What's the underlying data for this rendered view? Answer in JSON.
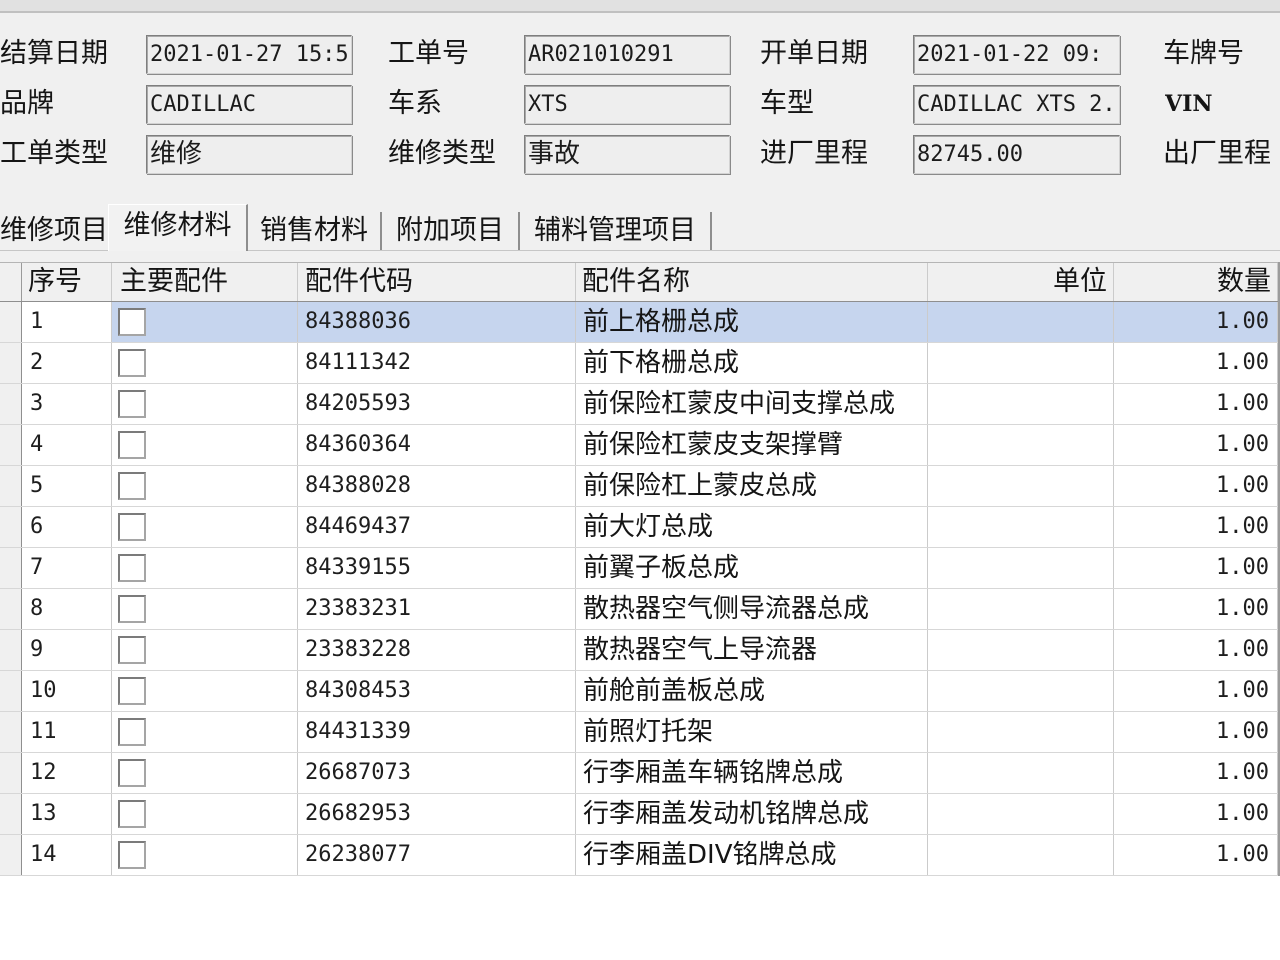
{
  "theme": {
    "selection": "#c6d5ee"
  },
  "form": {
    "settle_date": {
      "label": "结算日期",
      "value": "2021-01-27 15:5"
    },
    "work_order_no": {
      "label": "工单号",
      "value": "AR021010291"
    },
    "open_date": {
      "label": "开单日期",
      "value": "2021-01-22 09:"
    },
    "plate_no": {
      "label": "车牌号"
    },
    "brand": {
      "label": "品牌",
      "value": "CADILLAC"
    },
    "series": {
      "label": "车系",
      "value": "XTS"
    },
    "model": {
      "label": "车型",
      "value": "CADILLAC XTS 2."
    },
    "vin": {
      "label": "VIN"
    },
    "order_type": {
      "label": "工单类型",
      "value": "维修"
    },
    "repair_type": {
      "label": "维修类型",
      "value": "事故"
    },
    "in_mileage": {
      "label": "进厂里程",
      "value": "82745.00"
    },
    "out_mileage": {
      "label": "出厂里程"
    }
  },
  "tabs": [
    "维修项目",
    "维修材料",
    "销售材料",
    "附加项目",
    "辅料管理项目"
  ],
  "active_tab": 1,
  "parts_table": {
    "columns": {
      "seq": "序号",
      "main_part": "主要配件",
      "code": "配件代码",
      "name": "配件名称",
      "unit": "单位",
      "qty": "数量"
    },
    "selected_row": 0,
    "rows": [
      {
        "seq": "1",
        "main_part": false,
        "code": "84388036",
        "name": "前上格栅总成",
        "qty": "1.00"
      },
      {
        "seq": "2",
        "main_part": false,
        "code": "84111342",
        "name": "前下格栅总成",
        "qty": "1.00"
      },
      {
        "seq": "3",
        "main_part": false,
        "code": "84205593",
        "name": "前保险杠蒙皮中间支撑总成",
        "qty": "1.00"
      },
      {
        "seq": "4",
        "main_part": false,
        "code": "84360364",
        "name": "前保险杠蒙皮支架撑臂",
        "qty": "1.00"
      },
      {
        "seq": "5",
        "main_part": false,
        "code": "84388028",
        "name": "前保险杠上蒙皮总成",
        "qty": "1.00"
      },
      {
        "seq": "6",
        "main_part": false,
        "code": "84469437",
        "name": "前大灯总成",
        "qty": "1.00"
      },
      {
        "seq": "7",
        "main_part": false,
        "code": "84339155",
        "name": "前翼子板总成",
        "qty": "1.00"
      },
      {
        "seq": "8",
        "main_part": false,
        "code": "23383231",
        "name": "散热器空气侧导流器总成",
        "qty": "1.00"
      },
      {
        "seq": "9",
        "main_part": false,
        "code": "23383228",
        "name": "散热器空气上导流器",
        "qty": "1.00"
      },
      {
        "seq": "10",
        "main_part": false,
        "code": "84308453",
        "name": "前舱前盖板总成",
        "qty": "1.00"
      },
      {
        "seq": "11",
        "main_part": false,
        "code": "84431339",
        "name": "前照灯托架",
        "qty": "1.00"
      },
      {
        "seq": "12",
        "main_part": false,
        "code": "26687073",
        "name": "行李厢盖车辆铭牌总成",
        "qty": "1.00"
      },
      {
        "seq": "13",
        "main_part": false,
        "code": "26682953",
        "name": "行李厢盖发动机铭牌总成",
        "qty": "1.00"
      },
      {
        "seq": "14",
        "main_part": false,
        "code": "26238077",
        "name": "行李厢盖DIV铭牌总成",
        "qty": "1.00"
      }
    ]
  }
}
